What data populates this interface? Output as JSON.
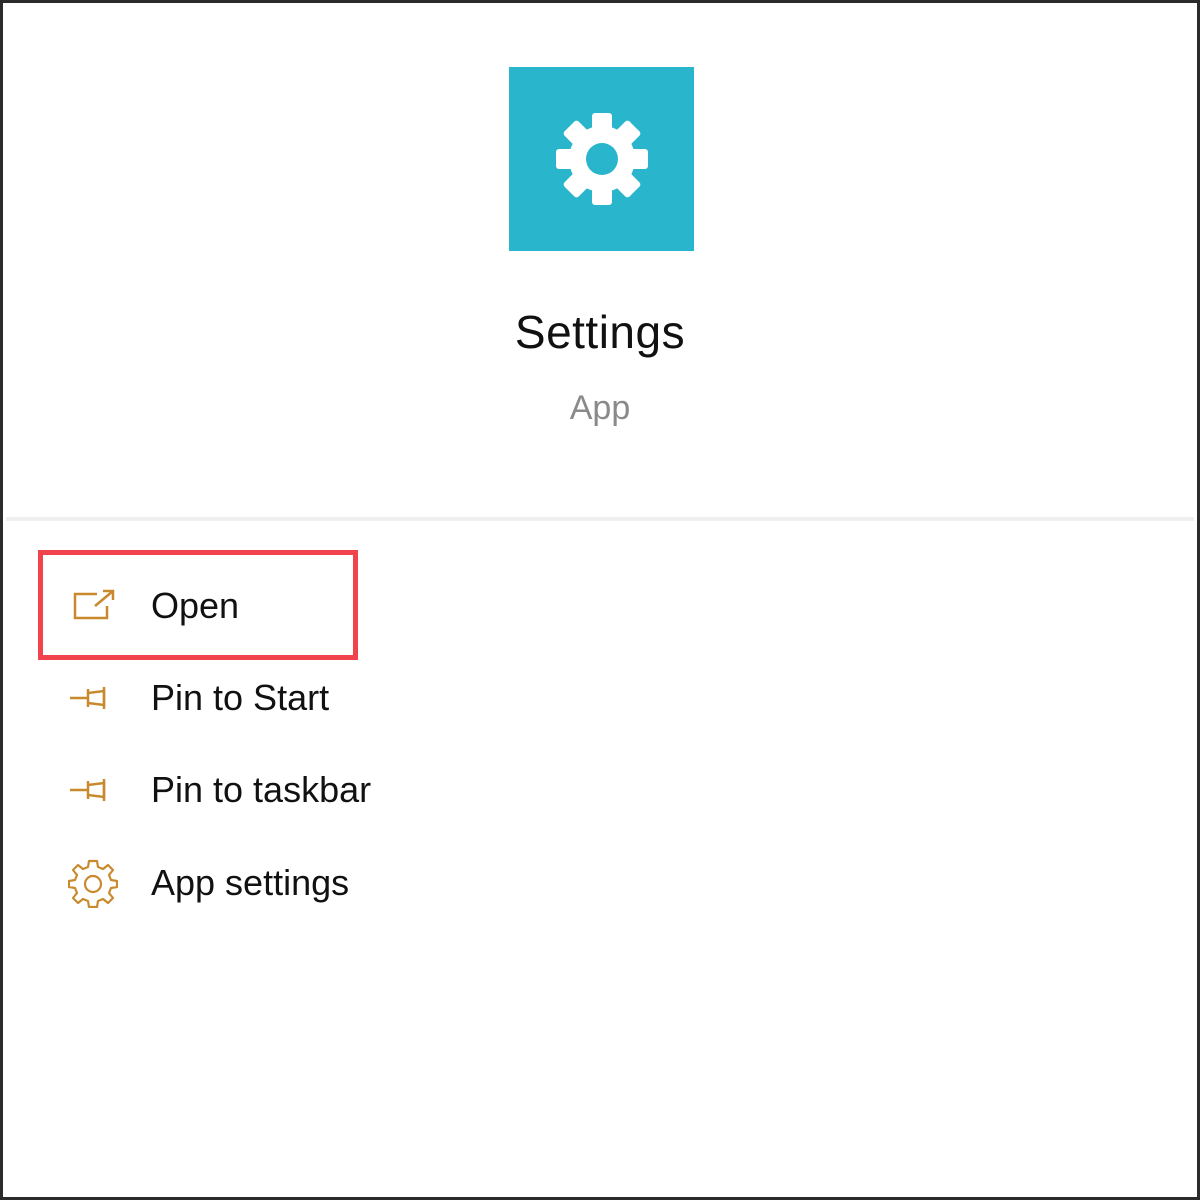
{
  "colors": {
    "tile_background": "#29b6cc",
    "tile_icon": "#ffffff",
    "menu_icon": "#c98a2e",
    "highlight": "#f0434b",
    "subtitle": "#8a8a8a"
  },
  "app": {
    "icon": "gear-icon",
    "name": "Settings",
    "kind": "App"
  },
  "menu": {
    "items": [
      {
        "label": "Open",
        "icon": "open-external-icon",
        "highlighted": true
      },
      {
        "label": "Pin to Start",
        "icon": "pin-icon",
        "highlighted": false
      },
      {
        "label": "Pin to taskbar",
        "icon": "pin-icon",
        "highlighted": false
      },
      {
        "label": "App settings",
        "icon": "gear-outline-icon",
        "highlighted": false
      }
    ]
  }
}
